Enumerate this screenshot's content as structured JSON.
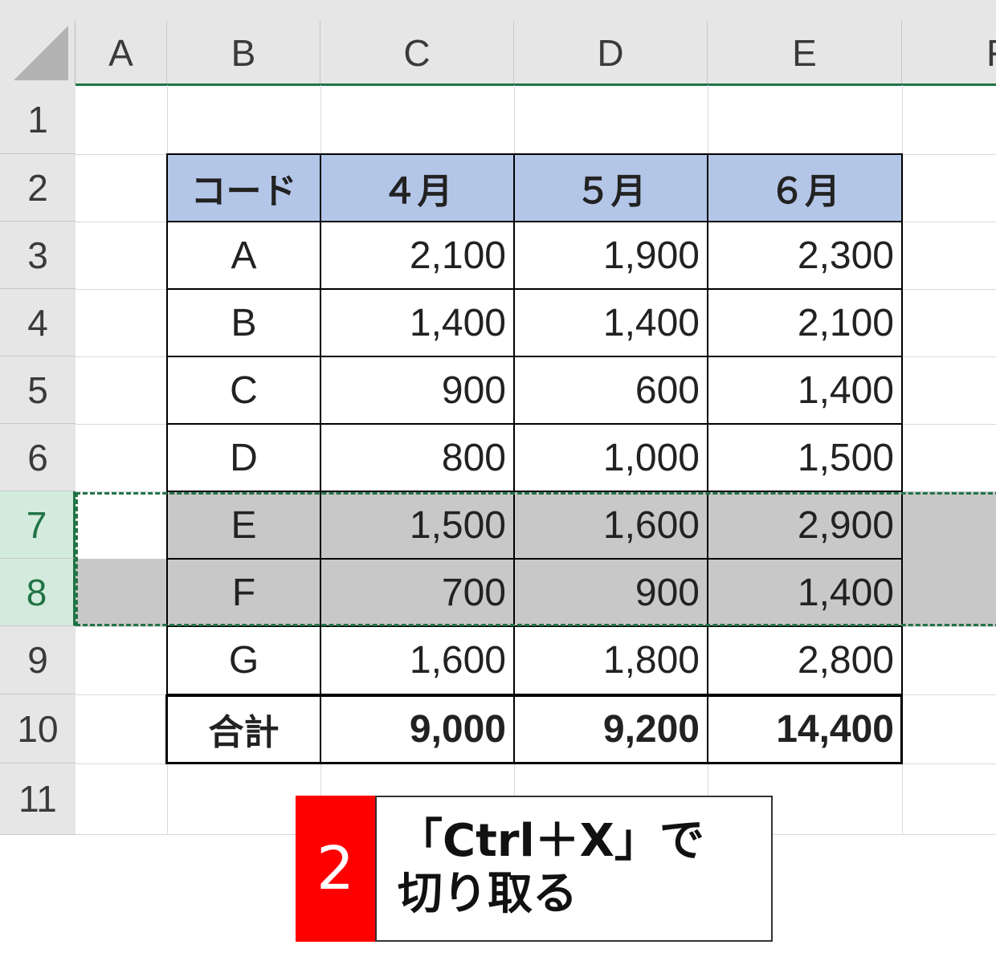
{
  "columns": [
    "A",
    "B",
    "C",
    "D",
    "E",
    "F"
  ],
  "rows": [
    "1",
    "2",
    "3",
    "4",
    "5",
    "6",
    "7",
    "8",
    "9",
    "10",
    "11"
  ],
  "table": {
    "header": [
      "コード",
      "４月",
      "５月",
      "６月"
    ],
    "body": [
      [
        "A",
        "2,100",
        "1,900",
        "2,300"
      ],
      [
        "B",
        "1,400",
        "1,400",
        "2,100"
      ],
      [
        "C",
        "900",
        "600",
        "1,400"
      ],
      [
        "D",
        "800",
        "1,000",
        "1,500"
      ],
      [
        "E",
        "1,500",
        "1,600",
        "2,900"
      ],
      [
        "F",
        "700",
        "900",
        "1,400"
      ],
      [
        "G",
        "1,600",
        "1,800",
        "2,800"
      ]
    ],
    "total": [
      "合計",
      "9,000",
      "9,200",
      "14,400"
    ]
  },
  "selected_rows": [
    "7",
    "8"
  ],
  "callout": {
    "step": "2",
    "line1": "「Ctrl＋X」で",
    "line2": "切り取る"
  },
  "colors": {
    "header_fill": "#b4c6e7",
    "selection_fill": "#c8c8c8",
    "selection_accent": "#217346",
    "badge": "#ff0000"
  }
}
